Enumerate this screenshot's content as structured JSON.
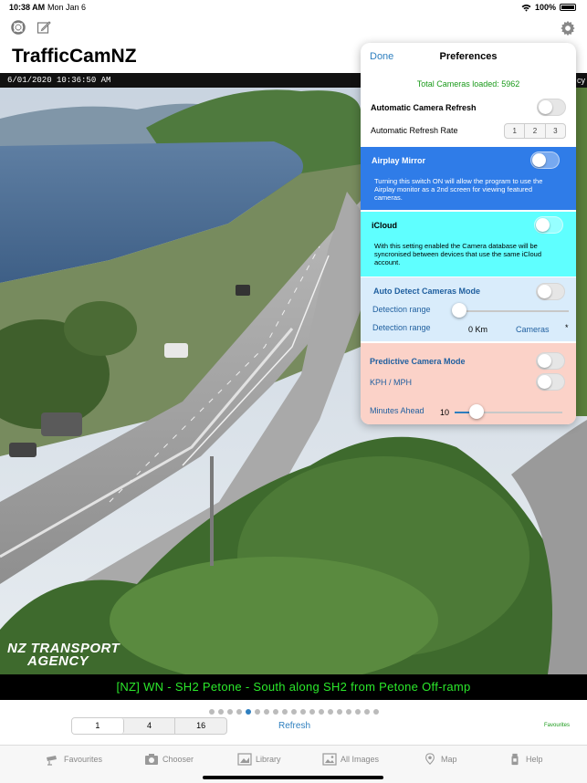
{
  "status": {
    "time": "10:38 AM",
    "date": "Mon Jan 6",
    "battery": "100%"
  },
  "app": {
    "title": "TrafficCamNZ"
  },
  "camera": {
    "timestamp": "6/01/2020 10:36:50 AM",
    "agency_fragment": "cy",
    "logo_line1": "NZ TRANSPORT",
    "logo_line2": "AGENCY",
    "caption": "[NZ] WN - SH2 Petone - South along SH2 from Petone Off-ramp"
  },
  "pager": {
    "count": 19,
    "active_index": 4
  },
  "grid_selector": {
    "options": [
      "1",
      "4",
      "16"
    ],
    "selected": "1"
  },
  "refresh_label": "Refresh",
  "favourites_label": "Favourites",
  "tabs": [
    {
      "label": "Favourites",
      "icon": "camera-icon"
    },
    {
      "label": "Chooser",
      "icon": "chooser-icon"
    },
    {
      "label": "Library",
      "icon": "library-icon"
    },
    {
      "label": "All Images",
      "icon": "images-icon"
    },
    {
      "label": "Map",
      "icon": "map-pin-icon"
    },
    {
      "label": "Help",
      "icon": "help-icon"
    }
  ],
  "preferences": {
    "done_label": "Done",
    "title": "Preferences",
    "cameras_loaded": "Total Cameras loaded: 5962",
    "auto_refresh": {
      "label": "Automatic Camera Refresh",
      "on": false
    },
    "refresh_rate": {
      "label": "Automatic Refresh Rate",
      "options": [
        "1",
        "2",
        "3"
      ]
    },
    "airplay": {
      "title": "Airplay Mirror",
      "on": false,
      "description": "Turning this switch ON will allow the program to use the Airplay monitor as a 2nd screen for viewing featured cameras.",
      "color": "#2f7ce8"
    },
    "icloud": {
      "title": "iCloud",
      "on": false,
      "description": "With this setting enabled the Camera database will be syncronised between devices that use the same iCloud account.",
      "color": "#5fffff"
    },
    "auto_detect": {
      "title": "Auto Detect Cameras Mode",
      "on": false,
      "detection_label_1": "Detection range",
      "detection_label_2": "Detection range",
      "range_value": "0 Km",
      "cameras_label": "Cameras",
      "asterisk": "*",
      "slider_fraction": 0.0,
      "color": "#d9ecfb"
    },
    "predictive": {
      "title": "Predictive Camera Mode",
      "on": false,
      "units_label": "KPH / MPH",
      "units_on": false,
      "minutes_label": "Minutes Ahead",
      "minutes_value": "10",
      "slider_fraction": 0.2,
      "color": "#fbd2c8"
    }
  }
}
